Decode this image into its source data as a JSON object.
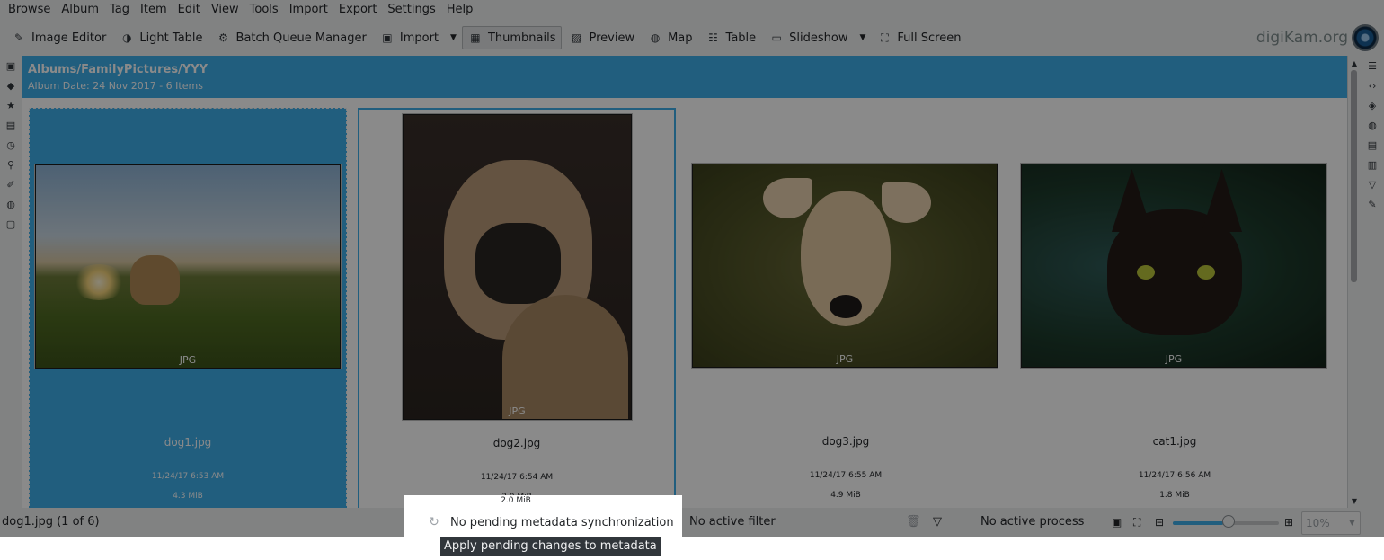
{
  "menu": [
    "Browse",
    "Album",
    "Tag",
    "Item",
    "Edit",
    "View",
    "Tools",
    "Import",
    "Export",
    "Settings",
    "Help"
  ],
  "toolbar": {
    "image_editor": "Image Editor",
    "light_table": "Light Table",
    "batch_queue": "Batch Queue Manager",
    "import": "Import",
    "thumbnails": "Thumbnails",
    "preview": "Preview",
    "map": "Map",
    "table": "Table",
    "slideshow": "Slideshow",
    "full_screen": "Full Screen",
    "brand": "digiKam.org"
  },
  "album": {
    "path": "Albums/FamilyPictures/YYY",
    "subtitle": "Album Date: 24 Nov 2017 - 6 Items"
  },
  "items": [
    {
      "name": "dog1.jpg",
      "date": "11/24/17 6:53 AM",
      "size": "4.3 MiB",
      "format": "JPG"
    },
    {
      "name": "dog2.jpg",
      "date": "11/24/17 6:54 AM",
      "size": "2.0 MiB",
      "format": "JPG"
    },
    {
      "name": "dog3.jpg",
      "date": "11/24/17 6:55 AM",
      "size": "4.9 MiB",
      "format": "JPG"
    },
    {
      "name": "cat1.jpg",
      "date": "11/24/17 6:56 AM",
      "size": "1.8 MiB",
      "format": "JPG"
    }
  ],
  "status": {
    "selection": "dog1.jpg (1 of 6)",
    "sync": "No pending metadata synchronization",
    "filter": "No active filter",
    "process": "No active process",
    "zoom": "10%",
    "tooltip": "Apply pending changes to metadata"
  },
  "colors": {
    "selection": "#3daee9",
    "chrome": "#eff0f1",
    "dim_opacity": 0.46
  }
}
